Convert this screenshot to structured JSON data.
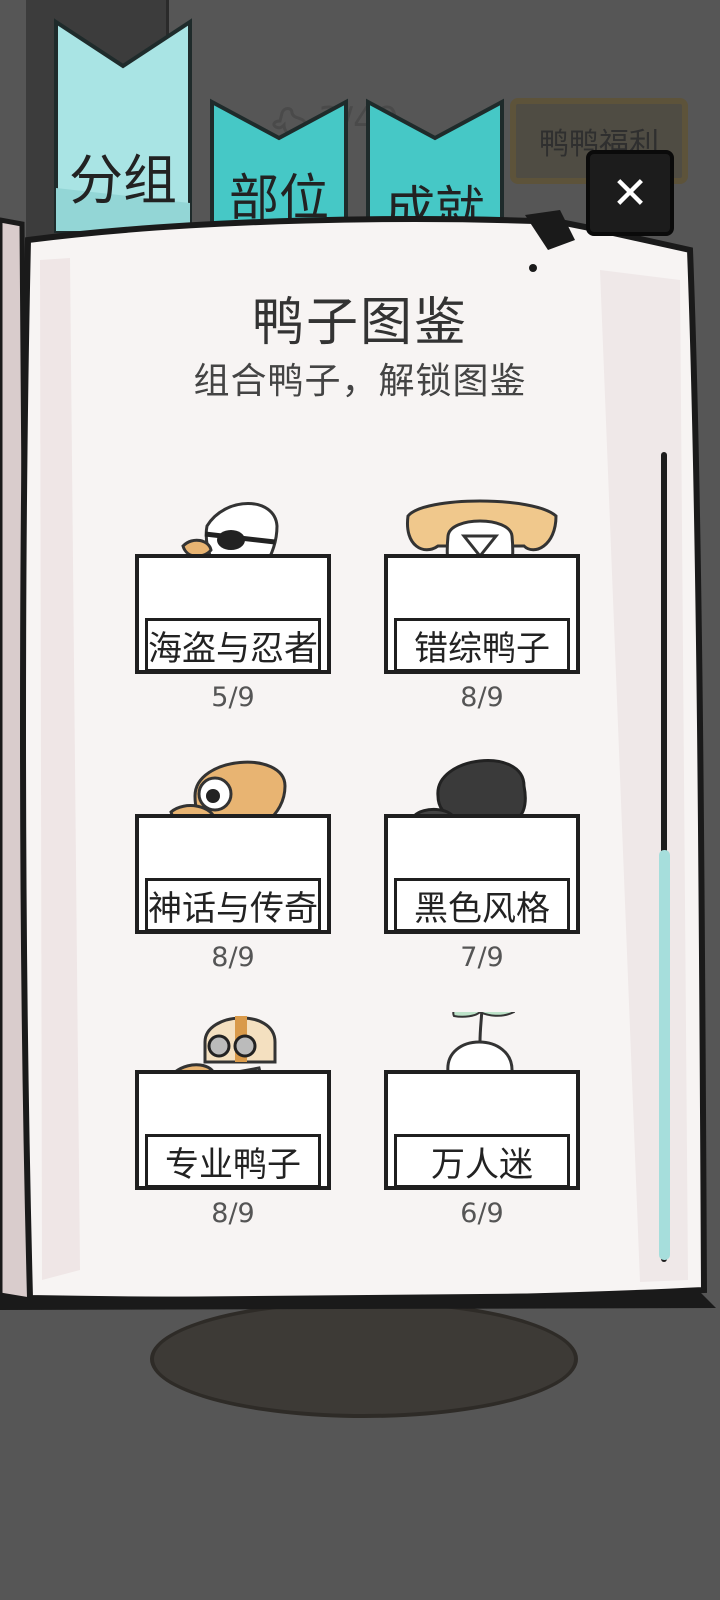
{
  "tabs": {
    "group": "分组",
    "parts": "部位",
    "achievement": "成就"
  },
  "background": {
    "counter": "3/49",
    "welfare_button": "鸭鸭福利"
  },
  "close_button": "✕",
  "title": "鸭子图鉴",
  "subtitle": "组合鸭子，解锁图鉴",
  "collections": [
    {
      "name": "海盗与忍者",
      "progress": "5/9"
    },
    {
      "name": "错综鸭子",
      "progress": "8/9"
    },
    {
      "name": "神话与传奇",
      "progress": "8/9"
    },
    {
      "name": "黑色风格",
      "progress": "7/9"
    },
    {
      "name": "专业鸭子",
      "progress": "8/9"
    },
    {
      "name": "万人迷",
      "progress": "6/9"
    }
  ],
  "colors": {
    "tab_active": "#a9e4e4",
    "tab_inactive": "#46c8c6",
    "page_bg": "#f7f4f3",
    "scroll_thumb": "#a6dedc"
  },
  "scroll": {
    "position_fraction": 0.5
  }
}
